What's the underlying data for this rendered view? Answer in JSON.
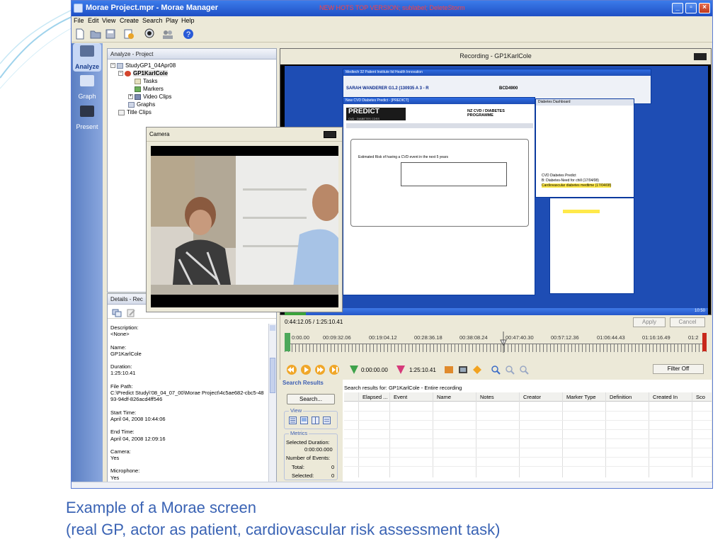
{
  "window": {
    "title": "Morae Project.mpr - Morae Manager",
    "watermark": "NEW HOTS TOP VERSION; sublabel; DeleteStorm"
  },
  "menu": [
    "File",
    "Edit",
    "View",
    "Create",
    "Search",
    "Play",
    "Help"
  ],
  "leftnav": [
    {
      "label": "Analyze",
      "icon": "analyze-icon",
      "active": true
    },
    {
      "label": "Graph",
      "icon": "graph-icon",
      "active": false
    },
    {
      "label": "Present",
      "icon": "present-icon",
      "active": false
    }
  ],
  "analyze": {
    "header": "Analyze - Project",
    "tree": [
      {
        "label": "StudyGP1_04Apr08",
        "expander": "−",
        "icon": "study-icon"
      },
      {
        "label": "GP1KarlCole",
        "expander": "−",
        "icon": "recording-icon",
        "selected": true
      },
      {
        "label": "Tasks",
        "icon": "tasks-icon"
      },
      {
        "label": "Markers",
        "icon": "markers-icon"
      },
      {
        "label": "Video Clips",
        "expander": "+",
        "icon": "video-clips-icon"
      },
      {
        "label": "Graphs",
        "icon": "graphs-icon"
      },
      {
        "label": "Title Clips",
        "icon": "title-clips-icon"
      }
    ]
  },
  "camera": {
    "title": "Camera"
  },
  "details": {
    "header": "Details - Rec",
    "fields": [
      {
        "label": "Description:",
        "value": "<None>"
      },
      {
        "label": "Name:",
        "value": "GP1KarlCole"
      },
      {
        "label": "Duration:",
        "value": "1:25:10.41"
      },
      {
        "label": "File Path:",
        "value": "C:\\Predict Study\\'08_04_07_00\\Morae Project\\4c5ae682-cbc5-4893-94df-826acd4ff546"
      },
      {
        "label": "Start Time:",
        "value": "April 04, 2008 10:44:06"
      },
      {
        "label": "End Time:",
        "value": "April 04, 2008 12:09:16"
      },
      {
        "label": "Camera:",
        "value": "Yes"
      },
      {
        "label": "Microphone:",
        "value": "Yes"
      }
    ]
  },
  "recording": {
    "title": "Recording - GP1KarlCole",
    "screen": {
      "main_title": "Medtech 32 Patient Institute ltd Health Innovation",
      "patient": "SARAH WANDERER G1.2 (130935 A 3 - R",
      "patient_code": "BCD4900",
      "predict_title": "New CVD Diabetes Predict - [PREDICT]",
      "predict_logo": "PREDICT",
      "predict_sub": "CVD · DIABETES CDSS",
      "programme": "NZ CVD / DIABETES PROGRAMME",
      "risk_line": "Estimated Risk of having a CVD event in the next 5 years",
      "side_items": [
        "CVD Diabetes Predict",
        "B: Diabetes-Need for chill (17/04/08)",
        "Cardiovascular diabetes medtime (17/04/08)"
      ],
      "side_title": "Diabetes Dashboard",
      "start_label": "start",
      "clock": "10:50"
    }
  },
  "playback": {
    "current_time": "0:44:12.05 / 1:25:10.41",
    "apply": "Apply",
    "cancel": "Cancel",
    "ticks": [
      "0:00.00",
      "00:09:32.06",
      "00:19:04.12",
      "00:28:36.18",
      "00:38:08.24",
      "00:47:40.30",
      "00:57:12.36",
      "01:06:44.43",
      "01:16:16.49",
      "01:2"
    ],
    "start_marker_time": "0:00:00.00",
    "end_marker_time": "1:25:10.41",
    "filter": "Filter Off",
    "playhead_fraction": 0.519
  },
  "search": {
    "header": "Search Results",
    "search_button": "Search...",
    "view_label": "View",
    "metrics_label": "Metrics",
    "selected_duration_label": "Selected Duration:",
    "selected_duration_value": "0:00:00.000",
    "events_label": "Number of Events:",
    "total_label": "Total:",
    "total_value": "0",
    "selected_label": "Selected:",
    "selected_value": "0",
    "results_title": "Search results for: GP1KarlCole - Entire recording",
    "columns": [
      "Elapsed ...",
      "Event",
      "Name",
      "Notes",
      "Creator",
      "Marker Type",
      "Definition",
      "Created In",
      "Sco"
    ]
  },
  "caption": {
    "line1": "Example of a Morae screen",
    "line2": "(real GP, actor as patient, cardiovascular risk assessment task)"
  },
  "colors": {
    "title_blue": "#1f4fc4",
    "caption": "#3a63b4",
    "nav": "#6f90d2"
  }
}
